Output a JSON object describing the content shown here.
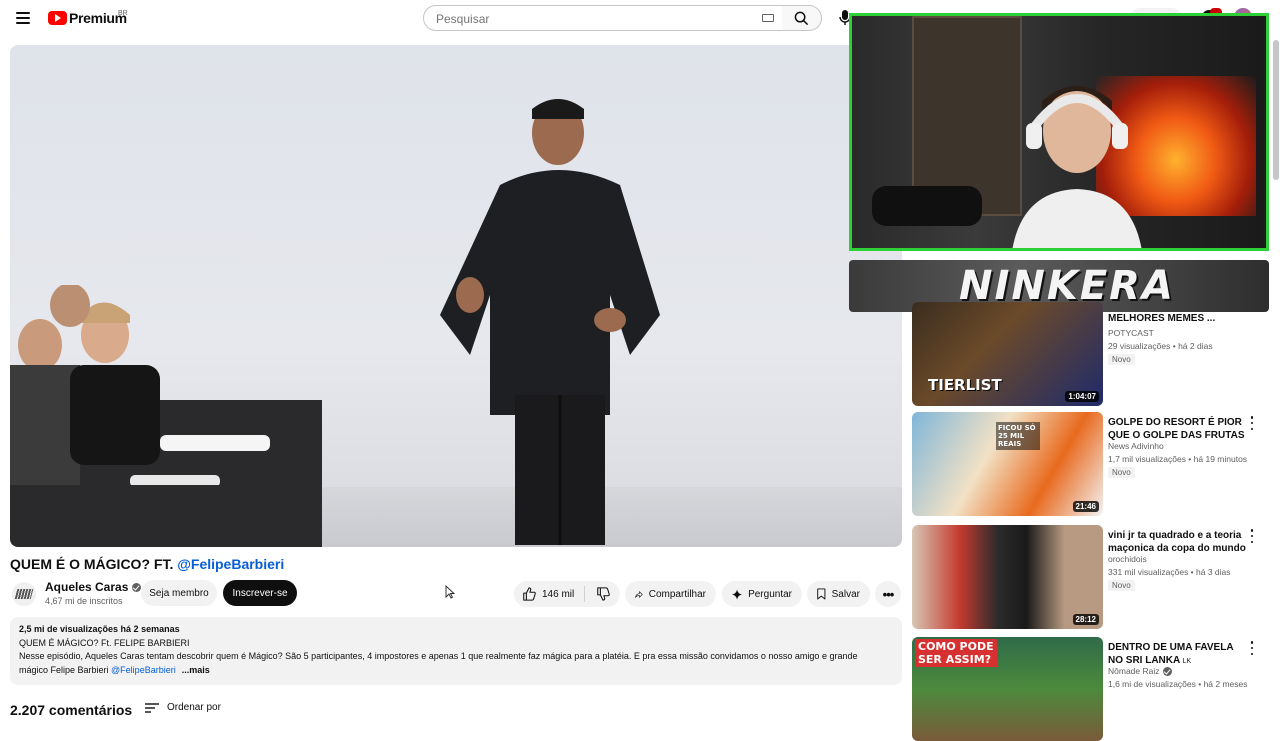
{
  "header": {
    "logo_text": "Premium",
    "logo_country": "BR",
    "search_placeholder": "Pesquisar"
  },
  "overlay": {
    "streamer_name": "NINKERA"
  },
  "video": {
    "title_main": "QUEM É O MÁGICO? FT. ",
    "title_mention": "@FelipeBarbieri",
    "channel_name": "Aqueles Caras",
    "subscribers": "4,67 mi de inscritos",
    "member_label": "Seja membro",
    "subscribe_label": "Inscrever-se",
    "likes": "146 mil",
    "share_label": "Compartilhar",
    "ask_label": "Perguntar",
    "save_label": "Salvar"
  },
  "description": {
    "meta": "2,5 mi de visualizações  há 2 semanas",
    "line1": "QUEM É MÁGICO? Ft. FELIPE BARBIERI",
    "line2": "Nesse episódio, Aqueles Caras tentam descobrir quem é Mágico? São 5 participantes, 4 impostores e apenas 1 que realmente faz mágica para a platéia. E pra essa missão convidamos o nosso amigo e grande",
    "line3": "mágico Felipe Barbieri ",
    "mention": "@FelipeBarbieri",
    "more": "...mais"
  },
  "comments": {
    "count_label": "2.207 comentários",
    "sort_label": "Ordenar por"
  },
  "recommendations": [
    {
      "title": "MELHORES MEMES ...",
      "channel": "POTYCAST",
      "meta": "29 visualizações • há 2 dias",
      "badge": "Novo",
      "duration": "1:04:07",
      "thumb_text": "TIERLIST"
    },
    {
      "title": "GOLPE DO RESORT É PIOR QUE O GOLPE DAS FRUTAS",
      "channel": "News Adivinho",
      "meta": "1,7 mil visualizações • há 19 minutos",
      "badge": "Novo",
      "duration": "21:46",
      "thumb_text": "FICOU SÓ 25 MIL REAIS"
    },
    {
      "title": "vini jr ta quadrado e a teoria maçonica da copa do mundo",
      "channel": "orochidois",
      "meta": "331 mil visualizações • há 3 dias",
      "badge": "Novo",
      "duration": "28:12",
      "thumb_text": ""
    },
    {
      "title": "DENTRO DE UMA FAVELA NO SRI LANKA",
      "title_suffix": "LK",
      "channel": "Nômade Raiz",
      "meta": "1,6 mi de visualizações • há 2 meses",
      "badge": "",
      "duration": "",
      "thumb_text": "COMO PODE SER ASSIM?"
    }
  ]
}
